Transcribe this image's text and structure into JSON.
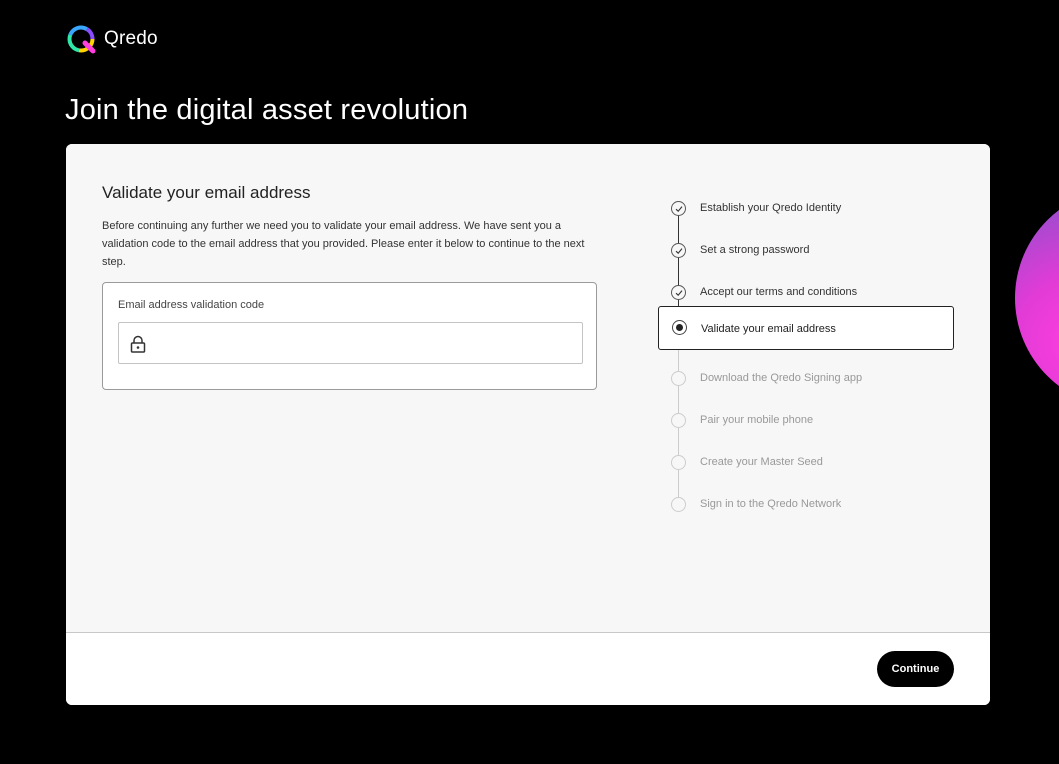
{
  "brand": {
    "name": "Qredo",
    "logo_icon": "qredo-logo-icon"
  },
  "page": {
    "title": "Join the digital asset revolution"
  },
  "form": {
    "title": "Validate your email address",
    "description": "Before continuing any further we need you to validate your email address. We have sent you a validation code to the email address that you provided. Please enter it below to continue to the next step.",
    "field_label": "Email address validation code",
    "field_value": "",
    "field_icon": "lock-icon"
  },
  "steps": [
    {
      "label": "Establish your Qredo Identity",
      "status": "done"
    },
    {
      "label": "Set a strong password",
      "status": "done"
    },
    {
      "label": "Accept our terms and conditions",
      "status": "done"
    },
    {
      "label": "Validate your email address",
      "status": "active"
    },
    {
      "label": "Download the Qredo Signing app",
      "status": "pending"
    },
    {
      "label": "Pair your mobile phone",
      "status": "pending"
    },
    {
      "label": "Create your Master Seed",
      "status": "pending"
    },
    {
      "label": "Sign in to the Qredo Network",
      "status": "pending"
    }
  ],
  "footer": {
    "continue_label": "Continue"
  },
  "colors": {
    "background": "#000000",
    "card": "#f7f7f7",
    "accent_gradient": [
      "#ff3ee0",
      "#6a4fb8"
    ]
  }
}
